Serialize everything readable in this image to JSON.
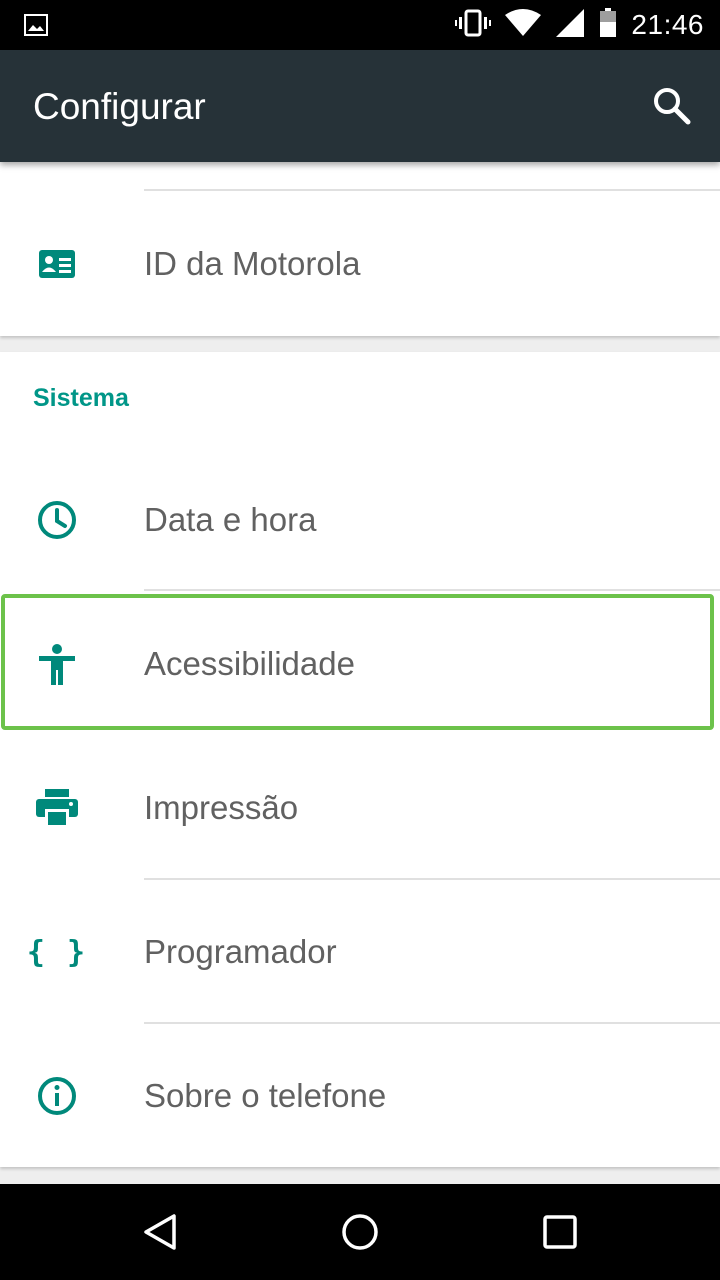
{
  "status_bar": {
    "time": "21:46",
    "icons": [
      "image-notification-icon",
      "vibrate-icon",
      "wifi-icon",
      "signal-icon",
      "battery-icon"
    ]
  },
  "app_bar": {
    "title": "Configurar",
    "search_icon": "search-icon"
  },
  "account_card": {
    "items": [
      {
        "label": "ID da Motorola",
        "icon": "id-card-icon"
      }
    ]
  },
  "system_section": {
    "header": "Sistema",
    "items": [
      {
        "label": "Data e hora",
        "icon": "clock-icon"
      },
      {
        "label": "Acessibilidade",
        "icon": "accessibility-icon",
        "highlighted": true
      },
      {
        "label": "Impressão",
        "icon": "printer-icon"
      },
      {
        "label": "Programador",
        "icon": "braces-icon",
        "icon_text": "{ }"
      },
      {
        "label": "Sobre o telefone",
        "icon": "info-icon"
      }
    ]
  },
  "nav_bar": {
    "buttons": [
      "back-button",
      "home-button",
      "recents-button"
    ]
  },
  "colors": {
    "accent": "#009688",
    "app_bar": "#263238",
    "highlight": "#6cc24a"
  }
}
